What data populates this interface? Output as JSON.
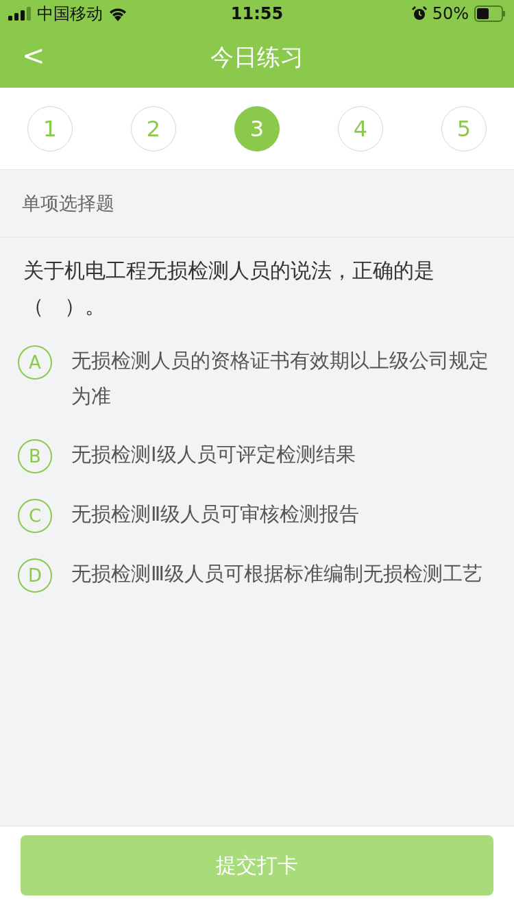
{
  "status_bar": {
    "carrier": "中国移动",
    "time": "11:55",
    "battery": "50%"
  },
  "nav": {
    "back": "<",
    "title": "今日练习"
  },
  "steps": [
    {
      "label": "1",
      "selected": false
    },
    {
      "label": "2",
      "selected": false
    },
    {
      "label": "3",
      "selected": true
    },
    {
      "label": "4",
      "selected": false
    },
    {
      "label": "5",
      "selected": false
    }
  ],
  "section": "单项选择题",
  "question": "关于机电工程无损检测人员的说法，正确的是（　）。",
  "options": [
    {
      "letter": "A",
      "text": "无损检测人员的资格证书有效期以上级公司规定为准",
      "selected": false
    },
    {
      "letter": "B",
      "text": "无损检测Ⅰ级人员可评定检测结果",
      "selected": false
    },
    {
      "letter": "C",
      "text": "无损检测Ⅱ级人员可审核检测报告",
      "selected": false
    },
    {
      "letter": "D",
      "text": "无损检测Ⅲ级人员可根据标准编制无损检测工艺",
      "selected": false
    }
  ],
  "submit": {
    "label": "提交打卡",
    "disabled": true
  }
}
